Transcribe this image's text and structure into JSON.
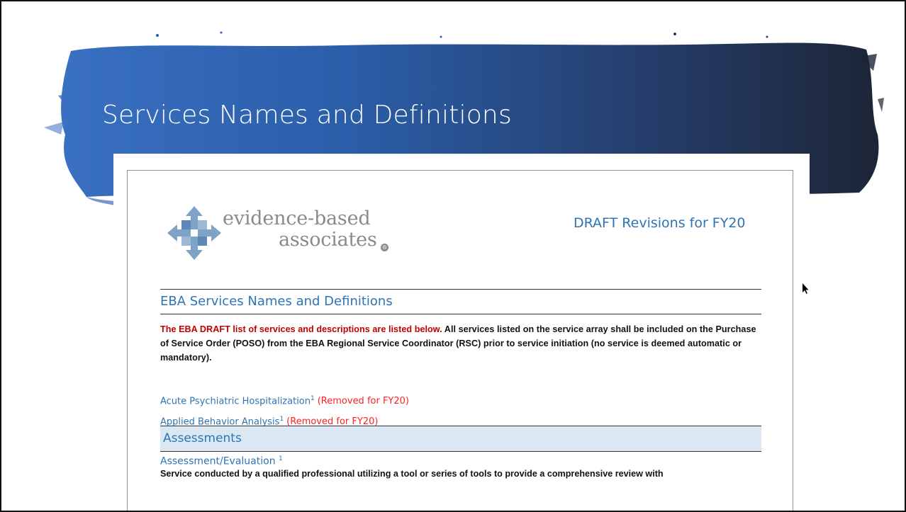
{
  "slide": {
    "title": "Services Names and Definitions"
  },
  "document": {
    "logo": {
      "line1": "evidence-based",
      "line2": "associates",
      "registered_mark": "®"
    },
    "header_title": "DRAFT Revisions for FY20",
    "section_heading": "EBA Services Names and Definitions",
    "intro": {
      "red_text": "The EBA DRAFT list of services and descriptions are listed below.",
      "rest_text": " All services listed on the service array shall be included on the Purchase of Service Order (POSO) from the EBA Regional Service Coordinator (RSC) prior to service initiation (no service is deemed automatic or mandatory)."
    },
    "services": [
      {
        "name": "Acute Psychiatric Hospitalization",
        "footnote": "1",
        "status": "(Removed for FY20)"
      },
      {
        "name": "Applied Behavior Analysis",
        "footnote": "1",
        "status": "(Removed for FY20)"
      }
    ],
    "category_heading": "Assessments",
    "subsection": {
      "title": "Assessment/Evaluation ",
      "footnote": "1",
      "body": "Service conducted by a qualified professional utilizing a tool or series of tools to provide a comprehensive review with"
    }
  },
  "colors": {
    "banner_dark": "#1f2d4a",
    "banner_blue": "#2f5fa8",
    "doc_blue": "#2e74b5",
    "removed_red": "#ff2020",
    "intro_red": "#c00000",
    "category_band": "#dbe7f3"
  }
}
